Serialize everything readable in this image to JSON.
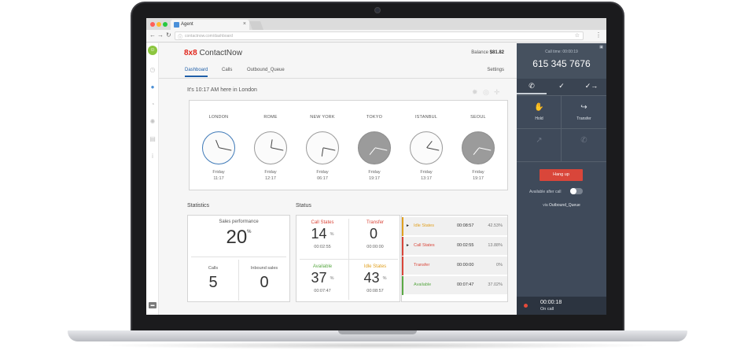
{
  "browser": {
    "tab_title": "Agent",
    "tab_close": "×",
    "url": "contactnow.com/dashboard"
  },
  "app": {
    "brand_prefix": "8x8",
    "brand_name": "ContactNow",
    "balance_label": "Balance",
    "balance_value": "$81.82",
    "tabs": [
      {
        "label": "Dashboard",
        "active": true
      },
      {
        "label": "Calls",
        "active": false
      },
      {
        "label": "Outbound_Queue",
        "active": false
      }
    ],
    "settings_label": "Settings",
    "local_time_text": "It's 10:17 AM here in London"
  },
  "clocks": [
    {
      "city": "LONDON",
      "day": "Friday",
      "time": "11:17",
      "hour": 11,
      "minute": 17,
      "style": "active"
    },
    {
      "city": "ROME",
      "day": "Friday",
      "time": "12:17",
      "hour": 12,
      "minute": 17,
      "style": "light"
    },
    {
      "city": "NEW YORK",
      "day": "Friday",
      "time": "06:17",
      "hour": 6,
      "minute": 17,
      "style": "light"
    },
    {
      "city": "TOKYO",
      "day": "Friday",
      "time": "19:17",
      "hour": 19,
      "minute": 17,
      "style": "dark"
    },
    {
      "city": "ISTANBUL",
      "day": "Friday",
      "time": "13:17",
      "hour": 13,
      "minute": 17,
      "style": "light"
    },
    {
      "city": "SEOUL",
      "day": "Friday",
      "time": "19:17",
      "hour": 19,
      "minute": 17,
      "style": "dark"
    }
  ],
  "statistics": {
    "title": "Statistics",
    "sales_performance_label": "Sales performance",
    "sales_performance_value": "20",
    "sales_performance_unit": "%",
    "calls_label": "Calls",
    "calls_value": "5",
    "inbound_sales_label": "Inbound sales",
    "inbound_sales_value": "0"
  },
  "status": {
    "title": "Status",
    "cells": [
      {
        "label": "Call States",
        "value": "14",
        "pct": "%",
        "time": "00:02:55",
        "color": "#d9463a"
      },
      {
        "label": "Transfer",
        "value": "0",
        "pct": "",
        "time": "00:00:00",
        "color": "#d9463a"
      },
      {
        "label": "Available",
        "value": "37",
        "pct": "%",
        "time": "00:07:47",
        "color": "#5aa845"
      },
      {
        "label": "Idle States",
        "value": "43",
        "pct": "%",
        "time": "00:08:57",
        "color": "#e0a020"
      }
    ],
    "rows": [
      {
        "arrow": "►",
        "name": "Idle States",
        "time": "00:08:57",
        "pct": "42.53%",
        "color": "#e0a020"
      },
      {
        "arrow": "►",
        "name": "Call States",
        "time": "00:02:55",
        "pct": "13.88%",
        "color": "#d9463a"
      },
      {
        "arrow": "",
        "name": "Transfer",
        "time": "00:00:00",
        "pct": "0%",
        "color": "#d9463a"
      },
      {
        "arrow": "",
        "name": "Available",
        "time": "00:07:47",
        "pct": "37.02%",
        "color": "#5aa845"
      }
    ]
  },
  "call_panel": {
    "call_time_label": "Call time: 00:00:19",
    "number": "615 345 7676",
    "hold_label": "Hold",
    "transfer_label": "Transfer",
    "hang_up_label": "Hang up",
    "available_after_call_label": "Available after call",
    "via_prefix": "via",
    "via_queue": "Outbound_Queue",
    "on_call_time": "00:00:18",
    "on_call_label": "On call"
  }
}
